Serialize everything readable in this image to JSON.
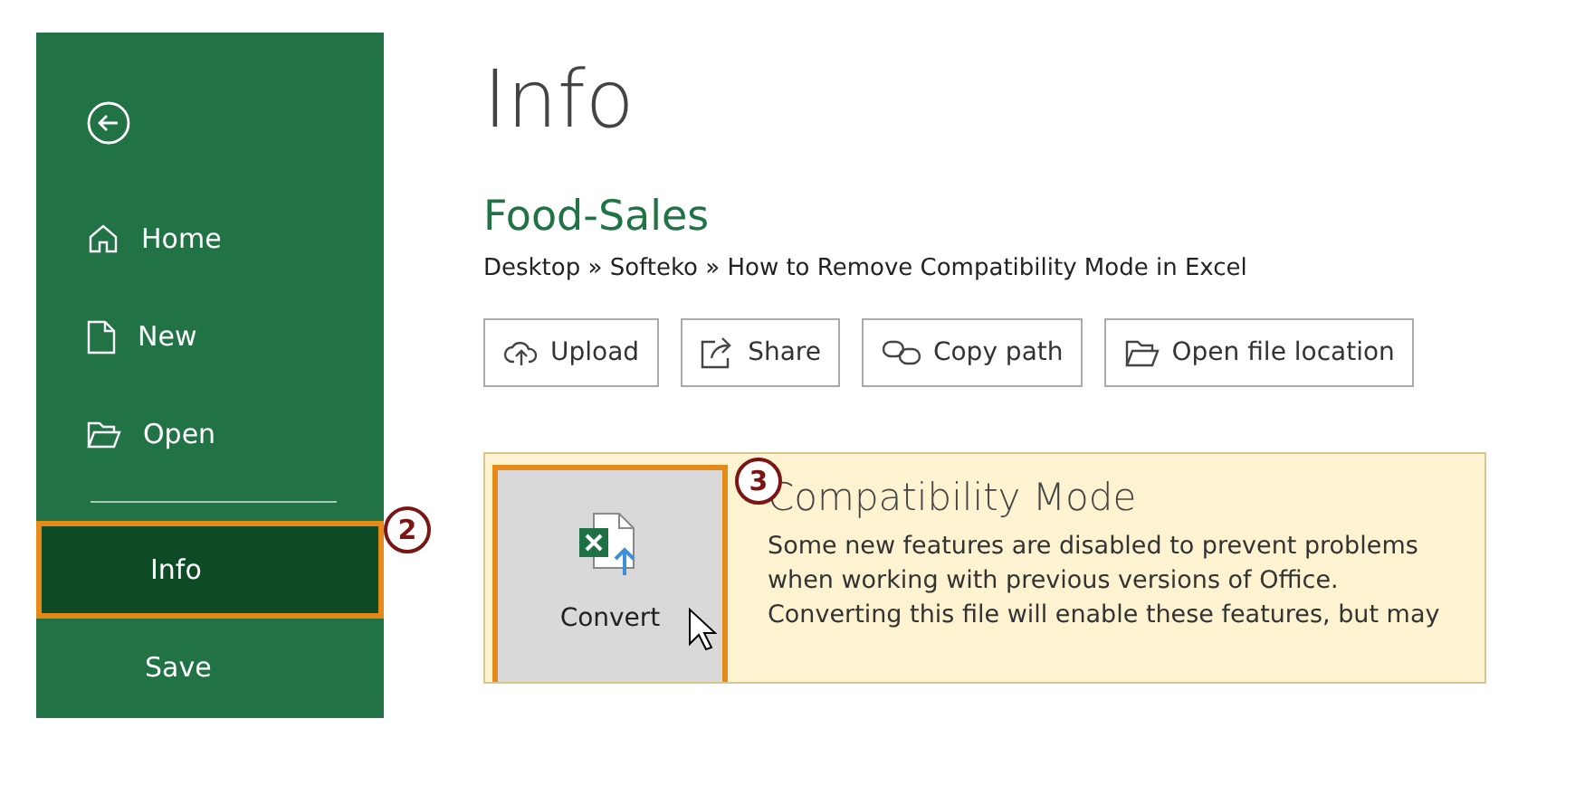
{
  "sidebar": {
    "items": [
      {
        "kind": "back"
      },
      {
        "kind": "home",
        "label": "Home",
        "selected": false
      },
      {
        "kind": "new",
        "label": "New",
        "selected": false
      },
      {
        "kind": "open",
        "label": "Open",
        "selected": false
      },
      {
        "kind": "divider"
      },
      {
        "kind": "plain",
        "label": "Info",
        "selected": true,
        "callout": "2"
      },
      {
        "kind": "plain",
        "label": "Save",
        "selected": false
      }
    ]
  },
  "page": {
    "title": "Info",
    "file_name": "Food-Sales",
    "path": "Desktop » Softeko » How to Remove Compatibility Mode in Excel",
    "actions": [
      {
        "kind": "upload",
        "label": "Upload"
      },
      {
        "kind": "share",
        "label": "Share"
      },
      {
        "kind": "link",
        "label": "Copy path"
      },
      {
        "kind": "folder",
        "label": "Open file location"
      }
    ],
    "compatibility": {
      "button": {
        "label": "Convert",
        "callout": "3"
      },
      "title": "Compatibility Mode",
      "text": "Some new features are disabled to prevent problems when working with previous versions of Office. Converting this file will enable these features, but may"
    }
  }
}
